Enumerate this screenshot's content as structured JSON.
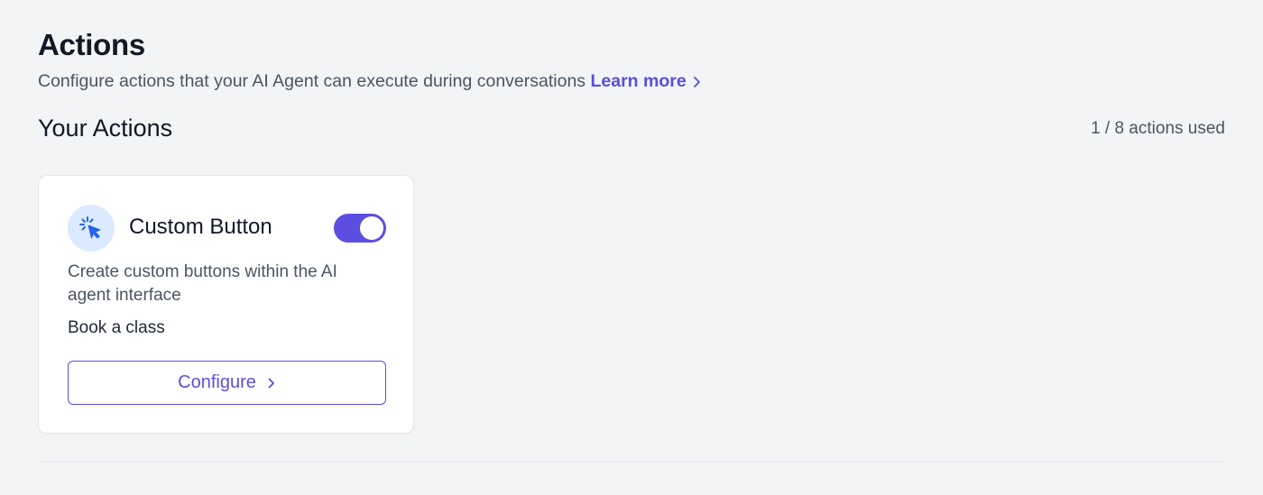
{
  "header": {
    "title": "Actions",
    "subtitle": "Configure actions that your AI Agent can execute during conversations",
    "learn_more": "Learn more"
  },
  "section": {
    "title": "Your Actions",
    "usage": "1 / 8 actions used"
  },
  "actions": [
    {
      "icon": "cursor-click-icon",
      "title": "Custom Button",
      "enabled": true,
      "description": "Create custom buttons within the AI agent interface",
      "value": "Book a class",
      "configure_label": "Configure"
    }
  ],
  "colors": {
    "accent": "#5b4ee0",
    "icon_bg": "#dbeafe",
    "icon_fg": "#2563eb",
    "page_bg": "#f3f4f6"
  }
}
